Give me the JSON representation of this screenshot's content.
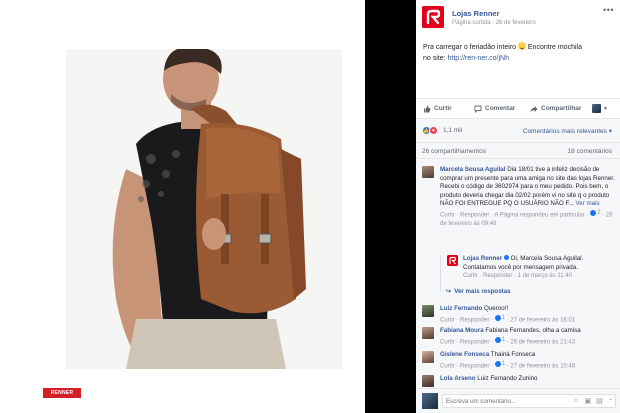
{
  "post": {
    "page_name": "Lojas Renner",
    "meta_label": "Página curtida",
    "date": "26 de fevereiro",
    "more_icon": "ellipsis-icon",
    "text_line1": "Pra carregar o feriadão inteiro ",
    "text_line1_after": " Encontre mochila",
    "text_line2_prefix": "no site: ",
    "link": "http://ren-ner.co/jNh",
    "brand_color": "#e2001a"
  },
  "photo": {
    "watermark": "RENNER"
  },
  "actions": {
    "like": "Curtir",
    "comment": "Comentar",
    "share": "Compartilhar"
  },
  "reactions": {
    "count": "1,1 mil",
    "relevance": "Comentários mais relevantes ▾",
    "shares": "26 compartilhamentos",
    "comments": "18 comentários"
  },
  "comments": [
    {
      "author": "Marcela Sousa Aguilal",
      "text": "Dia 18/01 tive a infeliz decisão de comprar um presente para uma amiga no site das lojas Renner. Recebi o código de 3602974 para o meu pedido. Pois bem, o produto deveria chegar dia 02/02 porém vi no site q o produto NÃO FOI ENTREGUE PQ O USUÁRIO NÃO F...",
      "see_more": "Ver mais",
      "links_prefix": "Curtir · Responder · A Página respondeu em particular · ",
      "likes": "2",
      "time": "· 28 de fevereiro às 09:48"
    },
    {
      "author": "Luiz Fernando",
      "text": "Queroo!!",
      "links_prefix": "Curtir · Responder · ",
      "likes": "1",
      "time": "· 27 de fevereiro às 16:01"
    },
    {
      "author": "Fabiana Moura",
      "text": "Fabiana Fernandes, olha a camisa",
      "links_prefix": "Curtir · Responder · ",
      "likes": "1",
      "time": "· 26 de fevereiro às 21:43"
    },
    {
      "author": "Gislene Fonseca",
      "text": "Thainá Fonseca",
      "links_prefix": "Curtir · Responder · ",
      "likes": "1",
      "time": "· 27 de fevereiro às 10:48"
    },
    {
      "author": "Lola Arseno",
      "text": "Luiz Fernando Zunino"
    }
  ],
  "reply": {
    "author": "Lojas Renner",
    "text": "Oi, Marcela Sousa Aguilal. Contatamos você por mensagem privada.",
    "links": "Curtir · Responder · 1 de março às 11:40"
  },
  "more_replies": "Ver mais respostas",
  "write": {
    "placeholder": "Escreva um comentário..."
  }
}
